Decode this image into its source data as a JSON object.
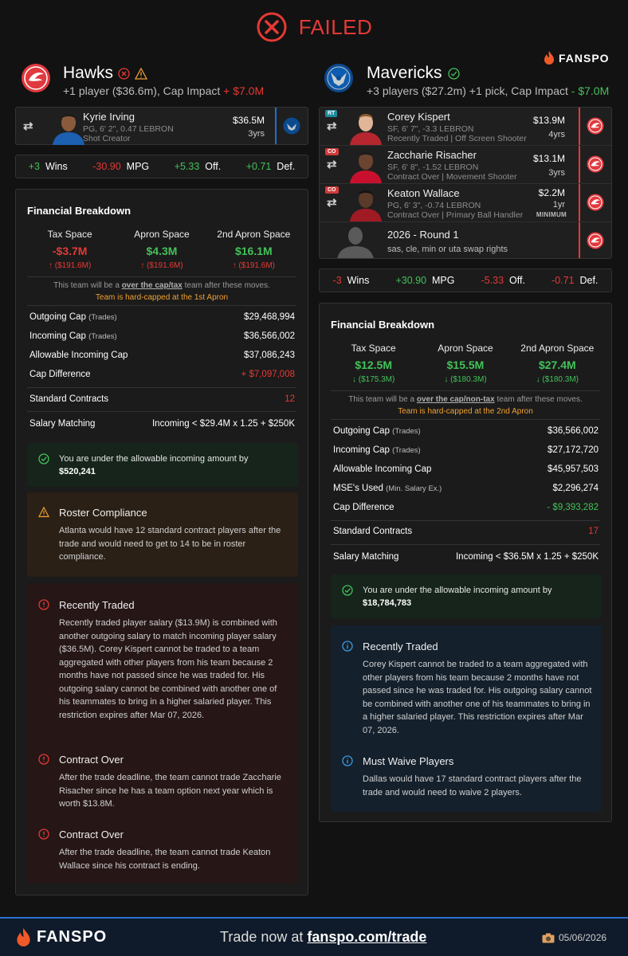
{
  "status": {
    "text": "FAILED"
  },
  "brand": {
    "name": "FANSPO"
  },
  "left": {
    "team": "Hawks",
    "summary_prefix": "+1 player ($36.6m), Cap Impact ",
    "cap_impact": "+ $7.0M",
    "players": [
      {
        "name": "Kyrie Irving",
        "meta1": "PG, 6' 2\", 0.47 LEBRON",
        "meta2": "Shot Creator",
        "salary": "$36.5M",
        "years": "3yrs"
      }
    ],
    "stats": {
      "wins_val": "+3",
      "wins_label": "Wins",
      "mpg_val": "-30.90",
      "mpg_label": "MPG",
      "off_val": "+5.33",
      "off_label": "Off.",
      "def_val": "+0.71",
      "def_label": "Def."
    },
    "financial": {
      "title": "Financial Breakdown",
      "spaces": [
        {
          "label": "Tax Space",
          "value": "-$3.7M",
          "sub": "($191.6M)"
        },
        {
          "label": "Apron Space",
          "value": "$4.3M",
          "sub": "($191.6M)"
        },
        {
          "label": "2nd Apron Space",
          "value": "$16.1M",
          "sub": "($191.6M)"
        }
      ],
      "note_prefix": "This team will be a ",
      "note_bold": "over the cap/tax",
      "note_suffix": " team after these moves.",
      "hardcap": "Team is hard-capped at the 1st Apron",
      "rows": [
        {
          "label": "Outgoing Cap",
          "small": "(Trades)",
          "value": "$29,468,994"
        },
        {
          "label": "Incoming Cap",
          "small": "(Trades)",
          "value": "$36,566,002"
        },
        {
          "label": "Allowable Incoming Cap",
          "small": "",
          "value": "$37,086,243"
        },
        {
          "label": "Cap Difference",
          "small": "",
          "value": "+ $7,097,008"
        }
      ],
      "standard_label": "Standard Contracts",
      "standard_value": "12",
      "matching_label": "Salary Matching",
      "matching_value": "Incoming < $29.4M x 1.25 + $250K"
    },
    "alert_ok": {
      "text": "You are under the allowable incoming amount by",
      "amount": "$520,241"
    },
    "roster": {
      "title": "Roster Compliance",
      "body": "Atlanta would have 12 standard contract players after the trade and would need to get to 14 to be in roster compliance."
    },
    "issues": [
      {
        "title": "Recently Traded",
        "body": "Recently traded player salary ($13.9M) is combined with another outgoing salary to match incoming player salary ($36.5M). Corey Kispert cannot be traded to a team aggregated with other players from his team because 2 months have not passed since he was traded for. His outgoing salary cannot be combined with another one of his teammates to bring in a higher salaried player. This restriction expires after Mar 07, 2026."
      },
      {
        "title": "Contract Over",
        "body": "After the trade deadline, the team cannot trade Zaccharie Risacher since he has a team option next year which is worth $13.8M."
      },
      {
        "title": "Contract Over",
        "body": "After the trade deadline, the team cannot trade Keaton Wallace since his contract is ending."
      }
    ]
  },
  "right": {
    "team": "Mavericks",
    "summary_prefix": "+3 players ($27.2m) +1 pick, Cap Impact ",
    "cap_impact": "- $7.0M",
    "players": [
      {
        "badge": "RT",
        "name": "Corey Kispert",
        "meta1": "SF, 6' 7\", -3.3 LEBRON",
        "meta2": "Recently Traded | Off Screen Shooter",
        "salary": "$13.9M",
        "years": "4yrs"
      },
      {
        "badge": "CO",
        "name": "Zaccharie Risacher",
        "meta1": "SF, 6' 8\", -1.52 LEBRON",
        "meta2": "Contract Over | Movement Shooter",
        "salary": "$13.1M",
        "years": "3yrs"
      },
      {
        "badge": "CO",
        "name": "Keaton Wallace",
        "meta1": "PG, 6' 3\", -0.74 LEBRON",
        "meta2": "Contract Over | Primary Ball Handler",
        "salary": "$2.2M",
        "years": "1yr",
        "tag": "MINIMUM"
      }
    ],
    "pick": {
      "title": "2026 - Round 1",
      "detail": "sas, cle, min or uta swap rights"
    },
    "stats": {
      "wins_val": "-3",
      "wins_label": "Wins",
      "mpg_val": "+30.90",
      "mpg_label": "MPG",
      "off_val": "-5.33",
      "off_label": "Off.",
      "def_val": "-0.71",
      "def_label": "Def."
    },
    "financial": {
      "title": "Financial Breakdown",
      "spaces": [
        {
          "label": "Tax Space",
          "value": "$12.5M",
          "sub": "($175.3M)"
        },
        {
          "label": "Apron Space",
          "value": "$15.5M",
          "sub": "($180.3M)"
        },
        {
          "label": "2nd Apron Space",
          "value": "$27.4M",
          "sub": "($180.3M)"
        }
      ],
      "note_prefix": "This team will be a ",
      "note_bold": "over the cap/non-tax",
      "note_suffix": " team after these moves.",
      "hardcap": "Team is hard-capped at the 2nd Apron",
      "rows": [
        {
          "label": "Outgoing Cap",
          "small": "(Trades)",
          "value": "$36,566,002"
        },
        {
          "label": "Incoming Cap",
          "small": "(Trades)",
          "value": "$27,172,720"
        },
        {
          "label": "Allowable Incoming Cap",
          "small": "",
          "value": "$45,957,503"
        },
        {
          "label": "MSE's Used",
          "small": "(Min. Salary Ex.)",
          "value": "$2,296,274"
        },
        {
          "label": "Cap Difference",
          "small": "",
          "value": "- $9,393,282"
        }
      ],
      "standard_label": "Standard Contracts",
      "standard_value": "17",
      "matching_label": "Salary Matching",
      "matching_value": "Incoming < $36.5M x 1.25 + $250K"
    },
    "alert_ok": {
      "text": "You are under the allowable incoming amount by",
      "amount": "$18,784,783"
    },
    "infos": [
      {
        "title": "Recently Traded",
        "body": "Corey Kispert cannot be traded to a team aggregated with other players from his team because 2 months have not passed since he was traded for. His outgoing salary cannot be combined with another one of his teammates to bring in a higher salaried player. This restriction expires after Mar 07, 2026."
      },
      {
        "title": "Must Waive Players",
        "body": "Dallas would have 17 standard contract players after the trade and would need to waive 2 players."
      }
    ]
  },
  "footer": {
    "brand": "FANSPO",
    "cta_prefix": "Trade now at ",
    "cta_link": "fanspo.com/trade",
    "date": "05/06/2026"
  },
  "colors": {
    "accent_red": "#e53935",
    "green": "#43c25a",
    "orange": "#f0a030",
    "footer_blue": "#2b6fd0"
  }
}
